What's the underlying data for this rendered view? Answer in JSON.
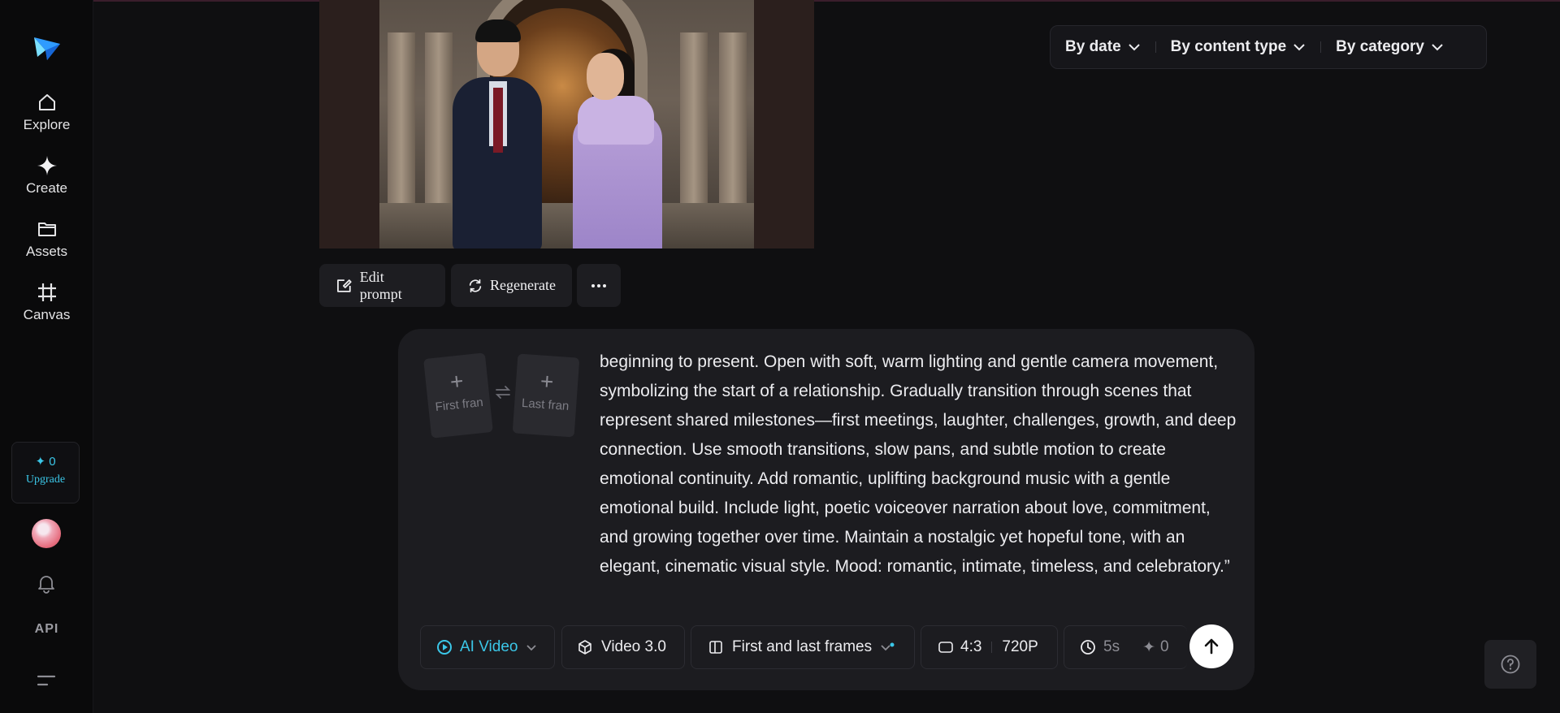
{
  "sidebar": {
    "items": [
      {
        "label": "Explore",
        "icon": "home-icon"
      },
      {
        "label": "Create",
        "icon": "sparkle-icon"
      },
      {
        "label": "Assets",
        "icon": "folder-icon"
      },
      {
        "label": "Canvas",
        "icon": "crop-icon"
      }
    ],
    "credits": "✦ 0",
    "upgrade_label": "Upgrade",
    "api_label": "API"
  },
  "actions": {
    "edit_prompt": "Edit prompt",
    "regenerate": "Regenerate"
  },
  "filters": {
    "by_date": "By date",
    "by_content_type": "By content type",
    "by_category": "By category"
  },
  "composer": {
    "first_frame_label": "First fran",
    "last_frame_label": "Last fran",
    "prompt_text": "beginning to present. Open with soft, warm lighting and gentle camera movement, symbolizing the start of a relationship. Gradually transition through scenes that represent shared milestones—first meetings, laughter, challenges, growth, and deep connection. Use smooth transitions, slow pans, and subtle motion to create emotional continuity. Add romantic, uplifting background music with a gentle emotional build. Include light, poetic voiceover narration about love, commitment, and growing together over time. Maintain a nostalgic yet hopeful tone, with an elegant, cinematic visual style. Mood: romantic, intimate, timeless, and celebratory.”",
    "mode": "AI Video",
    "model": "Video 3.0",
    "frame_mode": "First and last frames",
    "aspect_ratio": "4:3",
    "resolution": "720P",
    "duration": "5s",
    "cost": "0"
  },
  "colors": {
    "accent": "#3bc7e8",
    "background": "#0f0f11",
    "panel": "#1c1c20"
  }
}
